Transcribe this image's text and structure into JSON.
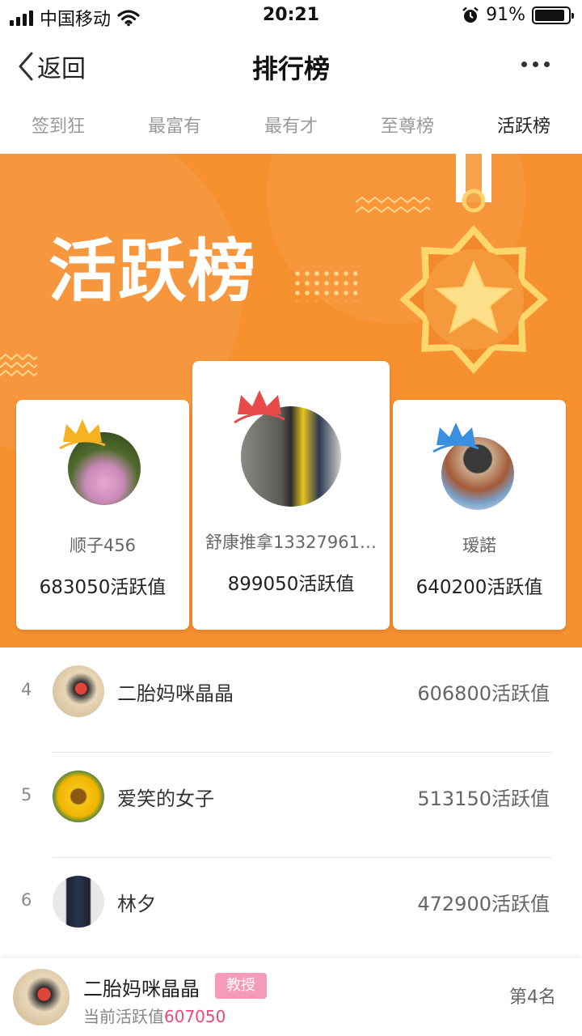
{
  "status_bar": {
    "carrier": "中国移动",
    "time": "20:21",
    "battery_percent": "91%",
    "battery_level": 0.91
  },
  "nav": {
    "back_label": "返回",
    "title": "排行榜"
  },
  "tabs": [
    {
      "label": "签到狂",
      "active": false
    },
    {
      "label": "最富有",
      "active": false
    },
    {
      "label": "最有才",
      "active": false
    },
    {
      "label": "至尊榜",
      "active": false
    },
    {
      "label": "活跃榜",
      "active": true
    }
  ],
  "banner": {
    "title": "活跃榜",
    "background_color": "#f7902f"
  },
  "podium": {
    "first": {
      "rank": 1,
      "name": "舒康推拿13327961…",
      "score": "899050活跃值",
      "crown_color": "#e84a4a"
    },
    "second": {
      "rank": 2,
      "name": "顺子456",
      "score": "683050活跃值",
      "crown_color": "#f5b323"
    },
    "third": {
      "rank": 3,
      "name": "瑷諾",
      "score": "640200活跃值",
      "crown_color": "#3b8fe0"
    }
  },
  "list": [
    {
      "rank": "4",
      "name": "二胎妈咪晶晶",
      "score": "606800活跃值"
    },
    {
      "rank": "5",
      "name": "爱笑的女子",
      "score": "513150活跃值"
    },
    {
      "rank": "6",
      "name": "林夕",
      "score": "472900活跃值"
    }
  ],
  "footer": {
    "name": "二胎妈咪晶晶",
    "badge": "教授",
    "current_label": "当前活跃值",
    "current_value": "607050",
    "my_rank": "第4名"
  },
  "colors": {
    "accent_pink": "#ea4a7a",
    "badge_pink": "#f59bb8"
  }
}
